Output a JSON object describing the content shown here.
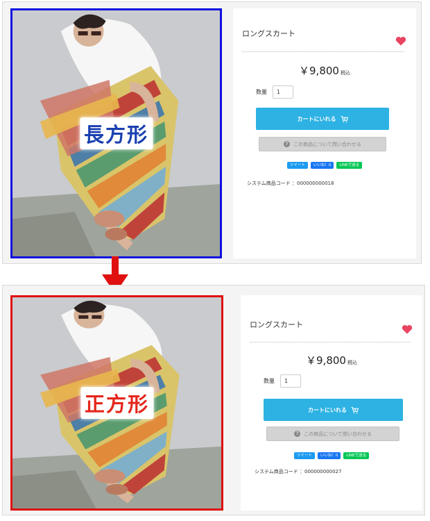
{
  "top_example": {
    "shape_label": "長方形",
    "frame_color": "#1010e0",
    "product": {
      "name": "ロングスカート",
      "price": "￥9,800",
      "tax_label": "税込",
      "quantity_label": "数量",
      "quantity_value": "1",
      "cart_button": "カートにいれる",
      "inquiry_button": "この商品について問い合わせる",
      "tweet_button": "ツイート",
      "like_button": "いいね！0",
      "line_button": "LINEで送る",
      "sku": "システム商品コード ：000000000018"
    }
  },
  "bottom_example": {
    "shape_label": "正方形",
    "frame_color": "#e01010",
    "product": {
      "name": "ロングスカート",
      "price": "￥9,800",
      "tax_label": "税込",
      "quantity_label": "数量",
      "quantity_value": "1",
      "cart_button": "カートにいれる",
      "inquiry_button": "この商品について問い合わせる",
      "tweet_button": "ツイート",
      "like_button": "いいね！0",
      "line_button": "LINEで送る",
      "sku": "システム商品コード ：000000000027"
    }
  },
  "colors": {
    "arrow": "#e01010",
    "heart": "#e94560",
    "cart_button": "#2db2e3",
    "inquiry_button": "#d3d3d3"
  },
  "icons": {
    "favorite": "heart-icon",
    "cart": "cart-icon",
    "inquiry": "question-circle-icon",
    "transition": "arrow-down-icon"
  }
}
